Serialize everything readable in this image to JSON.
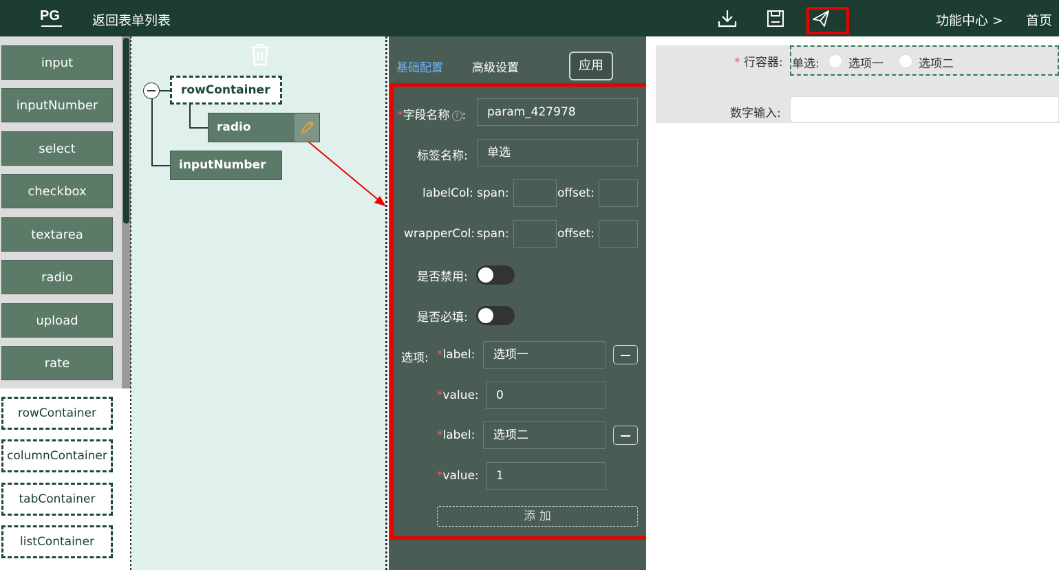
{
  "header": {
    "logo": "PG",
    "back_label": "返回表单列表",
    "func_center_label": "功能中心 >",
    "home_label": "首页"
  },
  "palette": {
    "components": [
      "input",
      "inputNumber",
      "select",
      "checkbox",
      "textarea",
      "radio",
      "upload",
      "rate"
    ],
    "containers": [
      "rowContainer",
      "columnContainer",
      "tabContainer",
      "listContainer"
    ]
  },
  "tree": {
    "row_node": "rowContainer",
    "radio_node": "radio",
    "number_node": "inputNumber"
  },
  "config": {
    "tab_basic": "基础配置",
    "tab_advanced": "高级设置",
    "apply_label": "应用",
    "field_name_label": "字段名称",
    "field_name_value": "param_427978",
    "tag_name_label": "标签名称:",
    "tag_name_value": "单选",
    "labelcol_label": "labelCol:",
    "wrappercol_label": "wrapperCol:",
    "span_label": "span:",
    "offset_label": "offset:",
    "disabled_label": "是否禁用:",
    "required_label": "是否必填:",
    "options_label": "选项:",
    "label_key": "label:",
    "value_key": "value:",
    "options": [
      {
        "label": "选项一",
        "value": "0"
      },
      {
        "label": "选项二",
        "value": "1"
      }
    ],
    "add_label": "添 加"
  },
  "preview": {
    "row_label": "行容器:",
    "radio_prefix": "单选:",
    "option1": "选项一",
    "option2": "选项二",
    "number_label": "数字输入:"
  },
  "colors": {
    "topbar": "#1c3d2f",
    "component_button": "#5b7a68",
    "config_panel": "#4a5d54",
    "highlight": "#ee0000",
    "tab_active": "#6cb2ff"
  }
}
